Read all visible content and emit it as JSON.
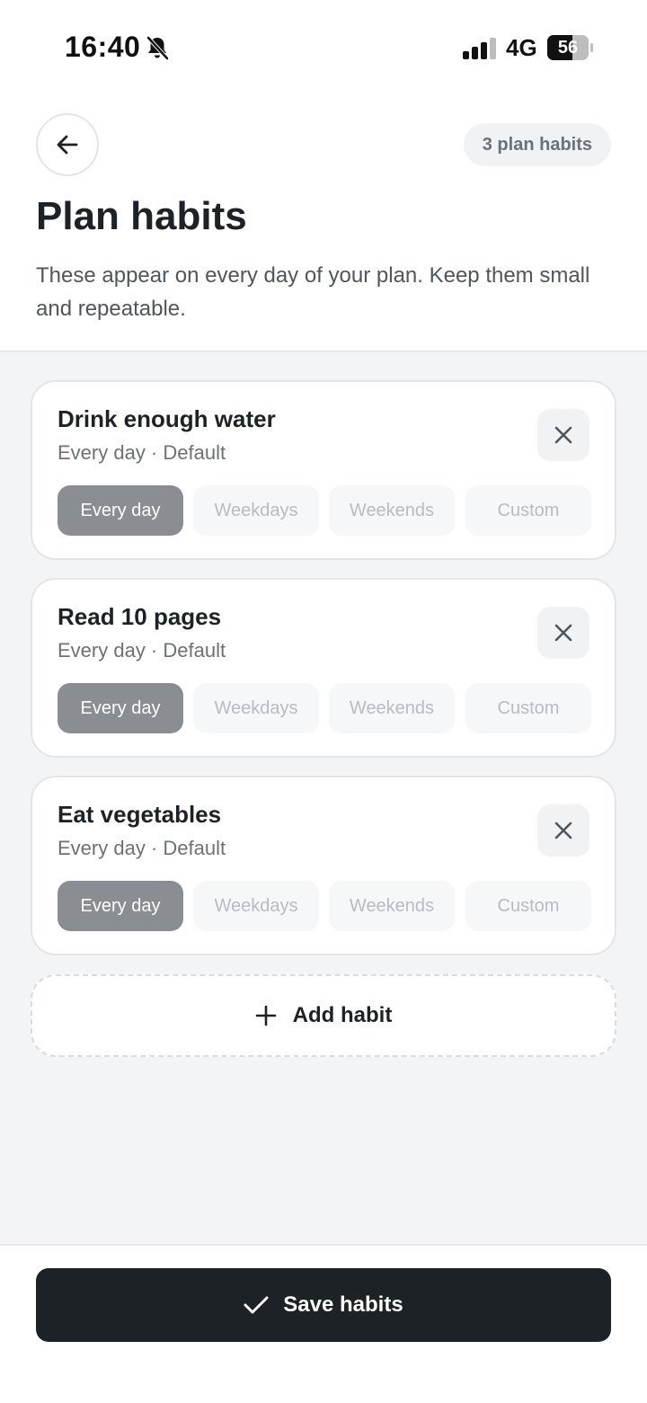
{
  "status_bar": {
    "time": "16:40",
    "network": "4G",
    "battery": "56"
  },
  "header": {
    "back_icon": "arrow-left-icon",
    "count_label": "3 plan habits",
    "title": "Plan habits",
    "description": "These appear on every day of your plan. Keep them small and repeatable."
  },
  "frequency_options": [
    "Every day",
    "Weekdays",
    "Weekends",
    "Custom"
  ],
  "habits": [
    {
      "name": "Drink enough water",
      "meta": "Every day · Default",
      "selected": "Every day"
    },
    {
      "name": "Read 10 pages",
      "meta": "Every day · Default",
      "selected": "Every day"
    },
    {
      "name": "Eat vegetables",
      "meta": "Every day · Default",
      "selected": "Every day"
    }
  ],
  "add_habit": {
    "label": "Add habit",
    "icon": "plus-icon"
  },
  "footer": {
    "save_label": "Save habits",
    "icon": "check-icon"
  },
  "colors": {
    "primary": "#1c2226",
    "chip_active": "#8a8e92",
    "background": "#f3f4f6"
  }
}
